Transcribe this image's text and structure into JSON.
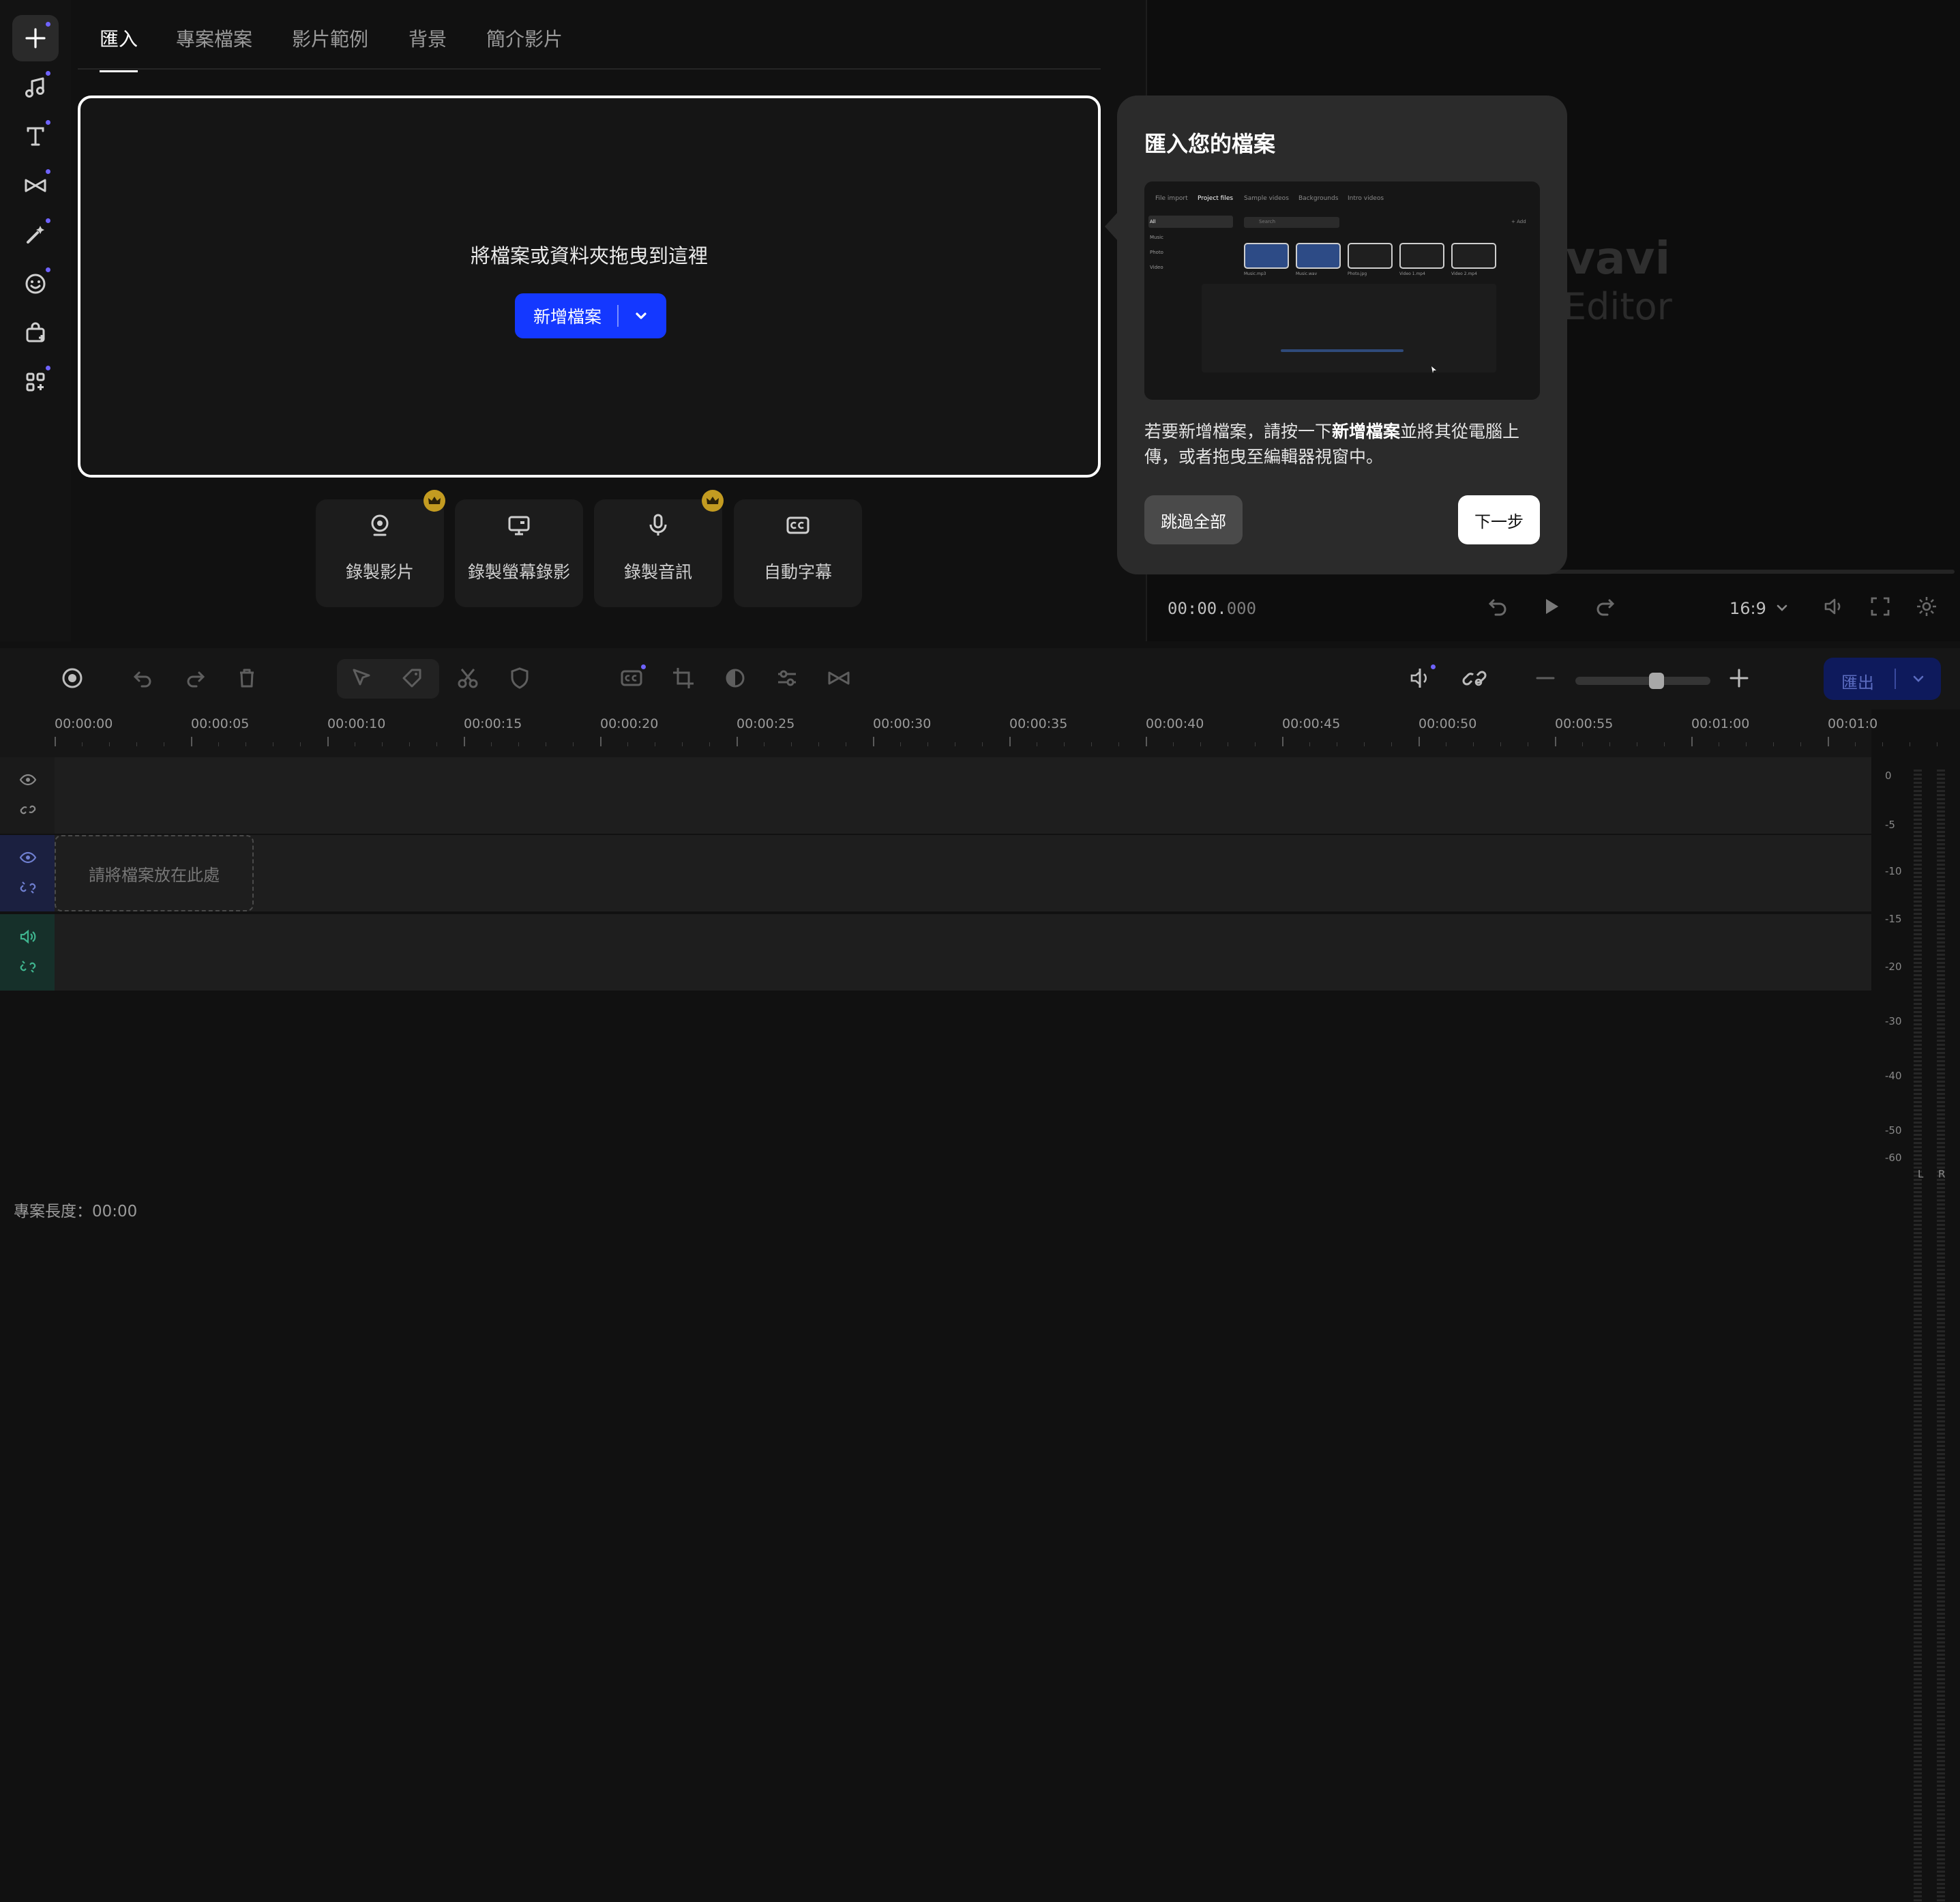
{
  "left_toolbar": {
    "items": [
      {
        "icon": "plus-icon",
        "active": true
      },
      {
        "icon": "music-note-icon"
      },
      {
        "icon": "text-icon"
      },
      {
        "icon": "transition-icon"
      },
      {
        "icon": "magic-wand-icon"
      },
      {
        "icon": "sticker-smile-icon"
      },
      {
        "icon": "shopping-bag-icon"
      },
      {
        "icon": "apps-grid-icon"
      }
    ]
  },
  "tabs": [
    "匯入",
    "專案檔案",
    "影片範例",
    "背景",
    "簡介影片"
  ],
  "dropzone": {
    "text": "將檔案或資料夾拖曳到這裡",
    "add_button": "新增檔案"
  },
  "record_cards": [
    {
      "label": "錄製影片",
      "icon": "webcam-icon",
      "premium": true
    },
    {
      "label": "錄製螢幕錄影",
      "icon": "monitor-icon",
      "premium": false
    },
    {
      "label": "錄製音訊",
      "icon": "microphone-icon",
      "premium": true
    },
    {
      "label": "自動字幕",
      "icon": "closed-captions-icon",
      "premium": false
    }
  ],
  "popup": {
    "title": "匯入您的檔案",
    "desc_part1": "若要新增檔案，請按一下",
    "desc_bold": "新增檔案",
    "desc_part2": "並將其從電腦上傳，或者拖曳至編輯器視窗中。",
    "skip_button": "跳過全部",
    "next_button": "下一步",
    "mini_screenshot": {
      "tabs": [
        "File import",
        "Project files",
        "Sample videos",
        "Backgrounds",
        "Intro videos"
      ],
      "active_tab": "Project files",
      "sidebar": [
        "All",
        "Music",
        "Photo",
        "Video"
      ],
      "search_placeholder": "Search",
      "add_label": "+ Add",
      "files": [
        "Music.mp3",
        "Music.wav",
        "Photo.jpg",
        "Video 1.mp4",
        "Video 2.mp4"
      ]
    }
  },
  "preview": {
    "logo_line1": "vavi",
    "logo_line2": "Editor",
    "timecode_main": "00:00.",
    "timecode_ms": "000",
    "aspect_ratio": "16:9"
  },
  "timeline": {
    "export_button": "匯出",
    "ruler_labels": [
      "00:00:00",
      "00:00:05",
      "00:00:10",
      "00:00:15",
      "00:00:20",
      "00:00:25",
      "00:00:30",
      "00:00:35",
      "00:00:40",
      "00:00:45",
      "00:00:50",
      "00:00:55",
      "00:01:00",
      "00:01:0"
    ],
    "drop_slot_text": "請將檔案放在此處",
    "meter_labels": [
      "0",
      "-5",
      "-10",
      "-15",
      "-20",
      "-30",
      "-40",
      "-50",
      "-60"
    ],
    "meter_channels": [
      "L",
      "R"
    ],
    "project_length_label": "專案長度：",
    "project_length_value": "00:00"
  },
  "colors": {
    "accent_blue": "#1438ff",
    "premium_gold": "#c39b21",
    "notification_dot": "#6f63ff"
  }
}
